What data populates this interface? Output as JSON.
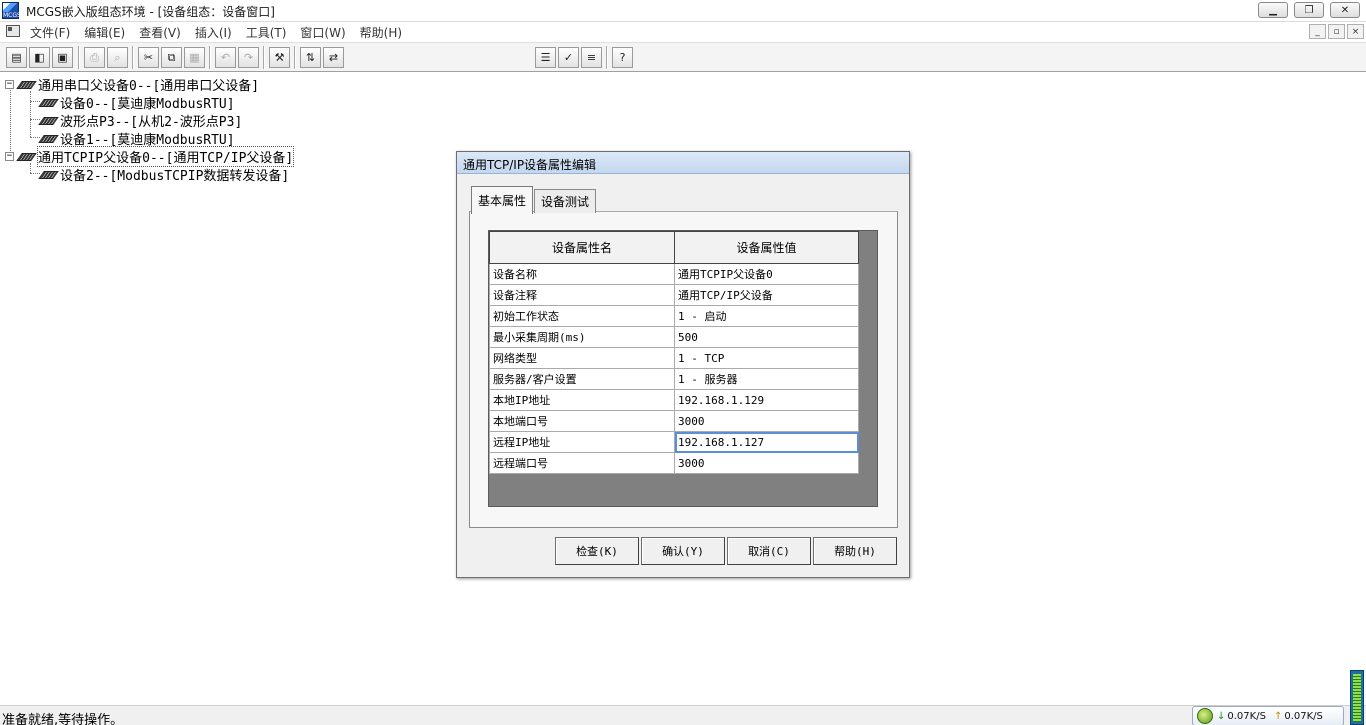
{
  "window": {
    "title": "MCGS嵌入版组态环境 - [设备组态：设备窗口]",
    "controls": [
      "▁",
      "❐",
      "✕"
    ]
  },
  "menubar": {
    "items": [
      "文件(F)",
      "编辑(E)",
      "查看(V)",
      "插入(I)",
      "工具(T)",
      "窗口(W)",
      "帮助(H)"
    ],
    "mdi_controls": [
      "_",
      "▫",
      "×"
    ]
  },
  "tree": {
    "items": [
      {
        "label": "通用串口父设备0--[通用串口父设备]",
        "level": 0,
        "expander": "−"
      },
      {
        "label": "设备0--[莫迪康ModbusRTU]",
        "level": 1
      },
      {
        "label": "波形点P3--[从机2-波形点P3]",
        "level": 1
      },
      {
        "label": "设备1--[莫迪康ModbusRTU]",
        "level": 1
      },
      {
        "label": "通用TCPIP父设备0--[通用TCP/IP父设备]",
        "level": 0,
        "expander": "−"
      },
      {
        "label": "设备2--[ModbusTCPIP数据转发设备]",
        "level": 1
      }
    ]
  },
  "dialog": {
    "title": "通用TCP/IP设备属性编辑",
    "tabs": [
      "基本属性",
      "设备测试"
    ],
    "active_tab": "基本属性",
    "columns": [
      "设备属性名",
      "设备属性值"
    ],
    "rows": [
      {
        "name": "设备名称",
        "value": "通用TCPIP父设备0"
      },
      {
        "name": "设备注释",
        "value": "通用TCP/IP父设备"
      },
      {
        "name": "初始工作状态",
        "value": "1 - 启动"
      },
      {
        "name": "最小采集周期(ms)",
        "value": "500"
      },
      {
        "name": "网络类型",
        "value": "1 - TCP"
      },
      {
        "name": "服务器/客户设置",
        "value": "1 - 服务器"
      },
      {
        "name": "本地IP地址",
        "value": "192.168.1.129"
      },
      {
        "name": "本地端口号",
        "value": "3000"
      },
      {
        "name": "远程IP地址",
        "value": "192.168.1.127"
      },
      {
        "name": "远程端口号",
        "value": "3000"
      }
    ],
    "buttons": {
      "check": "检查(K)",
      "confirm": "确认(Y)",
      "cancel": "取消(C)",
      "help": "帮助(H)"
    }
  },
  "statusbar": {
    "text": "准备就绪,等待操作。",
    "net_down": "0.07K/S",
    "net_up": "0.07K/S"
  },
  "colors": {
    "dialog_title_bg": "#c4d7ef",
    "grid_bg": "#808080",
    "editing_outline": "#5a8ed6"
  }
}
